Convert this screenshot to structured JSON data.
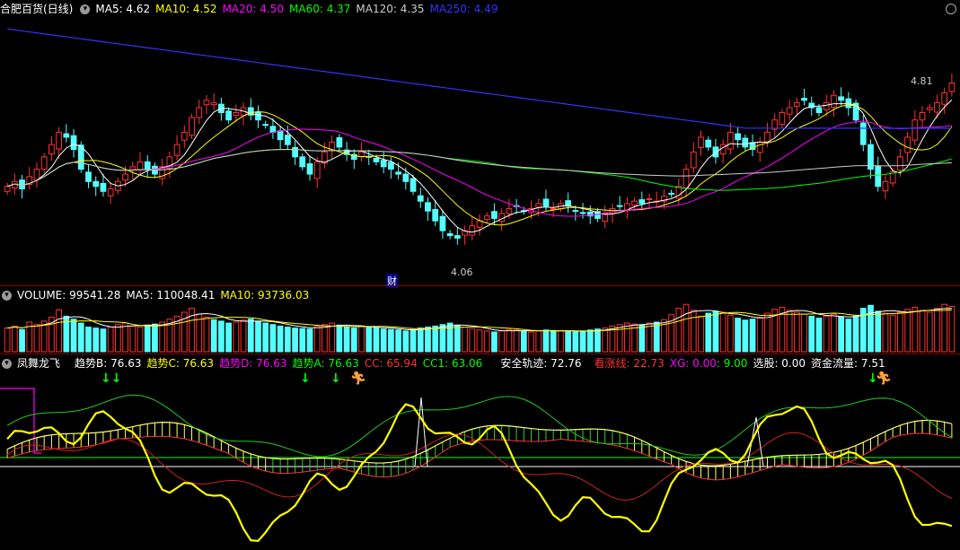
{
  "header": {
    "name": "合肥百货(日线)",
    "ma5": "MA5: 4.62",
    "ma10": "MA10: 4.52",
    "ma20": "MA20: 4.50",
    "ma60": "MA60: 4.37",
    "ma120": "MA120: 4.35",
    "ma250": "MA250: 4.49"
  },
  "annotations": {
    "high": "4.81",
    "low": "4.06",
    "cai": "财"
  },
  "volume_header": {
    "volume": "VOLUME: 99541.28",
    "ma5": "MA5: 110048.41",
    "ma10": "MA10: 93736.03"
  },
  "indicator_header": {
    "name": "凤舞龙飞",
    "trend_b": "趋势B: 76.63",
    "trend_c": "趋势C: 76.63",
    "trend_d": "趋势D: 76.63",
    "trend_a": "趋势A: 76.63",
    "cc": "CC: 65.94",
    "cc1": "CC1: 63.06",
    "safe": "安全轨迹: 72.76",
    "bear": "看涨线: 22.73",
    "xg": "XG: 0.00",
    "nine": ": 9.00",
    "pick": "选股: 0.00",
    "flow": "资金流量: 7.51"
  },
  "colors": {
    "up": "#ff3232",
    "down": "#54ffff",
    "ma5": "#ffffff",
    "ma10": "#ffff00",
    "ma20": "#ff00ff",
    "ma60": "#00ff00",
    "ma120": "#cccccc",
    "ma250": "#3333ff"
  },
  "chart_data": [
    {
      "type": "candlestick",
      "note": "daily price K-line with moving averages",
      "ylim": [
        3.9,
        4.95
      ],
      "closes": [
        4.28,
        4.3,
        4.27,
        4.32,
        4.35,
        4.4,
        4.45,
        4.5,
        4.48,
        4.43,
        4.35,
        4.3,
        4.28,
        4.26,
        4.27,
        4.3,
        4.33,
        4.36,
        4.38,
        4.35,
        4.33,
        4.36,
        4.4,
        4.45,
        4.5,
        4.56,
        4.6,
        4.63,
        4.62,
        4.58,
        4.55,
        4.58,
        4.6,
        4.57,
        4.55,
        4.53,
        4.5,
        4.47,
        4.45,
        4.4,
        4.36,
        4.33,
        4.38,
        4.42,
        4.46,
        4.44,
        4.41,
        4.39,
        4.42,
        4.4,
        4.38,
        4.36,
        4.35,
        4.33,
        4.3,
        4.26,
        4.22,
        4.18,
        4.14,
        4.1,
        4.08,
        4.07,
        4.1,
        4.12,
        4.14,
        4.16,
        4.15,
        4.17,
        4.19,
        4.2,
        4.18,
        4.19,
        4.21,
        4.2,
        4.19,
        4.21,
        4.2,
        4.18,
        4.17,
        4.16,
        4.15,
        4.17,
        4.19,
        4.2,
        4.21,
        4.22,
        4.21,
        4.23,
        4.22,
        4.24,
        4.25,
        4.28,
        4.35,
        4.42,
        4.48,
        4.44,
        4.4,
        4.45,
        4.5,
        4.47,
        4.44,
        4.43,
        4.46,
        4.5,
        4.55,
        4.58,
        4.6,
        4.62,
        4.63,
        4.6,
        4.58,
        4.62,
        4.65,
        4.63,
        4.6,
        4.55,
        4.45,
        4.35,
        4.28,
        4.3,
        4.34,
        4.4,
        4.48,
        4.55,
        4.58,
        4.6,
        4.62,
        4.66,
        4.7
      ],
      "moving_averages": {
        "MA5": 4.62,
        "MA10": 4.52,
        "MA20": 4.5,
        "MA60": 4.37,
        "MA120": 4.35,
        "MA250": 4.49
      }
    },
    {
      "type": "bar",
      "note": "volume bars",
      "values": [
        48,
        52,
        45,
        60,
        55,
        62,
        70,
        85,
        72,
        66,
        58,
        50,
        48,
        46,
        50,
        55,
        58,
        52,
        50,
        54,
        56,
        60,
        66,
        72,
        80,
        88,
        76,
        70,
        65,
        62,
        58,
        60,
        64,
        66,
        62,
        58,
        55,
        52,
        50,
        48,
        47,
        46,
        52,
        55,
        58,
        54,
        50,
        48,
        52,
        50,
        48,
        46,
        45,
        44,
        42,
        45,
        48,
        50,
        52,
        55,
        58,
        54,
        50,
        46,
        44,
        42,
        40,
        42,
        45,
        44,
        42,
        40,
        42,
        44,
        43,
        42,
        41,
        40,
        42,
        44,
        46,
        48,
        52,
        55,
        58,
        56,
        54,
        58,
        60,
        65,
        75,
        88,
        96,
        84,
        72,
        78,
        82,
        80,
        74,
        68,
        64,
        66,
        70,
        78,
        86,
        90,
        84,
        80,
        76,
        72,
        68,
        72,
        76,
        70,
        66,
        72,
        88,
        94,
        82,
        78,
        74,
        80,
        86,
        90,
        84,
        80,
        88,
        96,
        92
      ]
    },
    {
      "type": "line",
      "note": "凤舞龙飞 oscillator",
      "series_summary": {
        "趋势B": 76.63,
        "趋势C": 76.63,
        "趋势D": 76.63,
        "趋势A": 76.63,
        "CC": 65.94,
        "CC1": 63.06,
        "安全轨迹": 72.76,
        "看涨线": 22.73,
        "XG": 0.0,
        "选股": 0.0,
        "资金流量": 7.51
      }
    }
  ]
}
